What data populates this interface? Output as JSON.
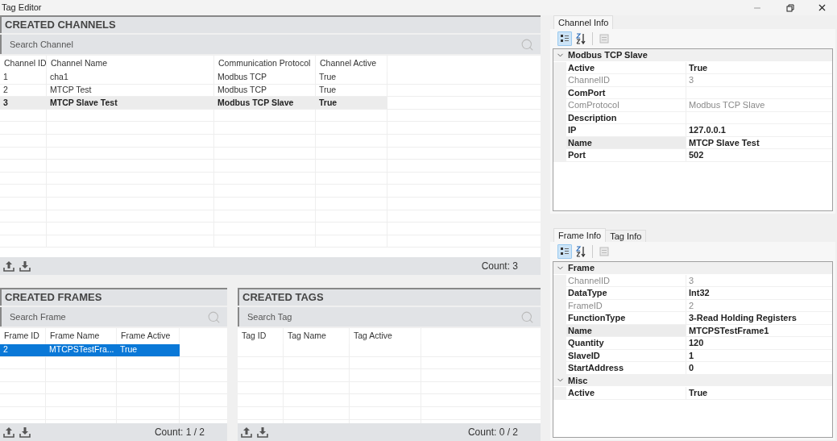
{
  "window": {
    "title": "Tag Editor"
  },
  "channels": {
    "title": "CREATED CHANNELS",
    "search": {
      "placeholder": "Search Channel"
    },
    "columns": [
      "Channel ID",
      "Channel Name",
      "Communication Protocol",
      "Channel Active"
    ],
    "rows": [
      {
        "cells": [
          "1",
          "cha1",
          "Modbus TCP",
          "True"
        ],
        "selected": false
      },
      {
        "cells": [
          "2",
          "MTCP Test",
          "Modbus TCP",
          "True"
        ],
        "selected": false
      },
      {
        "cells": [
          "3",
          "MTCP Slave Test",
          "Modbus TCP Slave",
          "True"
        ],
        "selected": true
      }
    ],
    "count": "Count: 3"
  },
  "frames": {
    "title": "CREATED FRAMES",
    "search": {
      "placeholder": "Search Frame"
    },
    "columns": [
      "Frame ID",
      "Frame Name",
      "Frame Active"
    ],
    "rows": [
      {
        "cells": [
          "2",
          "MTCPSTestFra...",
          "True"
        ],
        "selected": true
      }
    ],
    "count": "Count: 1 / 2"
  },
  "tags": {
    "title": "CREATED TAGS",
    "search": {
      "placeholder": "Search Tag"
    },
    "columns": [
      "Tag ID",
      "Tag Name",
      "Tag Active"
    ],
    "count": "Count: 0 / 2"
  },
  "channel_info": {
    "tabs": [
      {
        "label": "Channel Info",
        "selected": true
      }
    ],
    "toolbar": [
      {
        "kind": "categorized",
        "selected": true
      },
      {
        "kind": "alphabetical",
        "selected": false
      },
      {
        "kind": "pages",
        "selected": false
      }
    ],
    "categories": [
      {
        "label": "Modbus TCP Slave",
        "expanded": true,
        "properties": [
          {
            "name": "Active",
            "value": "True",
            "readonly": false,
            "selected": false
          },
          {
            "name": "ChannelID",
            "value": "3",
            "readonly": true,
            "selected": false
          },
          {
            "name": "ComPort",
            "readonly": false,
            "selected": false
          },
          {
            "name": "ComProtocol",
            "value": "Modbus TCP Slave",
            "readonly": true,
            "selected": false
          },
          {
            "name": "Description",
            "readonly": false,
            "selected": false
          },
          {
            "name": "IP",
            "value": "127.0.0.1",
            "readonly": false,
            "selected": false
          },
          {
            "name": "Name",
            "value": "MTCP Slave Test",
            "readonly": false,
            "selected": true
          },
          {
            "name": "Port",
            "value": "502",
            "readonly": false,
            "selected": false
          }
        ]
      }
    ]
  },
  "frame_info": {
    "tabs": [
      {
        "label": "Frame Info",
        "selected": true
      },
      {
        "label": "Tag Info",
        "selected": false
      }
    ],
    "toolbar": [
      {
        "kind": "categorized",
        "selected": true
      },
      {
        "kind": "alphabetical",
        "selected": false
      },
      {
        "kind": "pages",
        "selected": false
      }
    ],
    "categories": [
      {
        "label": "Frame",
        "expanded": true,
        "properties": [
          {
            "name": "ChannelID",
            "value": "3",
            "readonly": true,
            "selected": false
          },
          {
            "name": "DataType",
            "value": "Int32",
            "readonly": false,
            "selected": false
          },
          {
            "name": "FrameID",
            "value": "2",
            "readonly": true,
            "selected": false
          },
          {
            "name": "FunctionType",
            "value": "3-Read Holding Registers",
            "readonly": false,
            "selected": false
          },
          {
            "name": "Name",
            "value": "MTCPSTestFrame1",
            "readonly": false,
            "selected": true
          },
          {
            "name": "Quantity",
            "value": "120",
            "readonly": false,
            "selected": false
          },
          {
            "name": "SlaveID",
            "value": "1",
            "readonly": false,
            "selected": false
          },
          {
            "name": "StartAddress",
            "value": "0",
            "readonly": false,
            "selected": false
          }
        ]
      },
      {
        "label": "Misc",
        "expanded": true,
        "properties": [
          {
            "name": "Active",
            "value": "True",
            "readonly": false,
            "selected": false
          }
        ]
      }
    ]
  }
}
